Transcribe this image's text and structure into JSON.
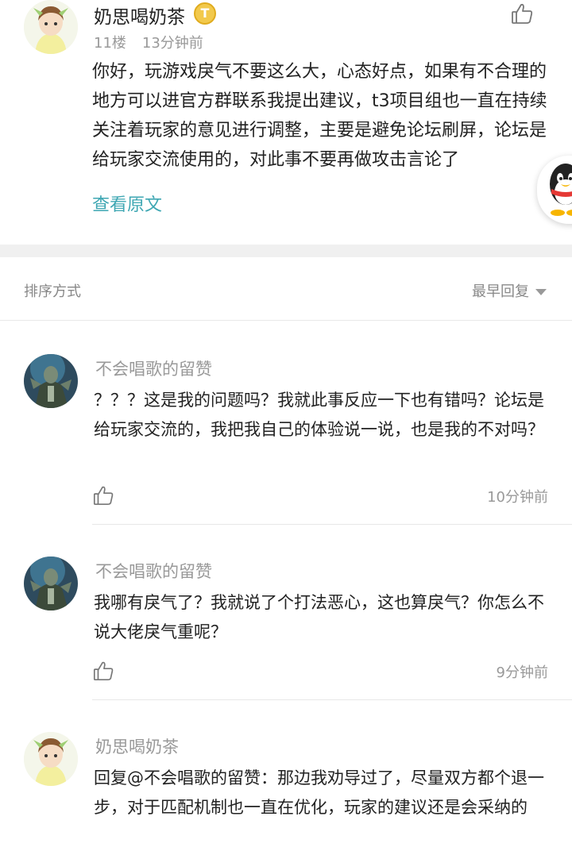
{
  "post": {
    "author": "奶思喝奶茶",
    "badge": "T",
    "floor": "11楼",
    "time": "13分钟前",
    "body": "你好，玩游戏戾气不要这么大，心态好点，如果有不合理的地方可以进官方群联系我提出建议，t3项目组也一直在持续关注着玩家的意见进行调整，主要是避免论坛刷屏，论坛是给玩家交流使用的，对此事不要再做攻击言论了",
    "view_original": "查看原文"
  },
  "sort": {
    "label": "排序方式",
    "selected": "最早回复"
  },
  "replies": [
    {
      "author": "不会唱歌的留赞",
      "text": "？？？这是我的问题吗？我就此事反应一下也有错吗？论坛是给玩家交流的，我把我自己的体验说一说，也是我的不对吗？",
      "time": "10分钟前"
    },
    {
      "author": "不会唱歌的留赞",
      "text": "我哪有戾气了？我就说了个打法恶心，这也算戾气？你怎么不说大佬戾气重呢？",
      "time": "9分钟前"
    },
    {
      "author": "奶思喝奶茶",
      "text": "回复@不会唱歌的留赞：那边我劝导过了，尽量双方都个退一步，对于匹配机制也一直在优化，玩家的建议还是会采纳的",
      "time": ""
    }
  ],
  "colors": {
    "link": "#3fa7b3",
    "muted": "#999999",
    "badge": "#f2c94c"
  },
  "icons": {
    "like": "thumbs-up-icon",
    "sort_caret": "caret-down-icon",
    "qq": "qq-penguin-icon"
  }
}
